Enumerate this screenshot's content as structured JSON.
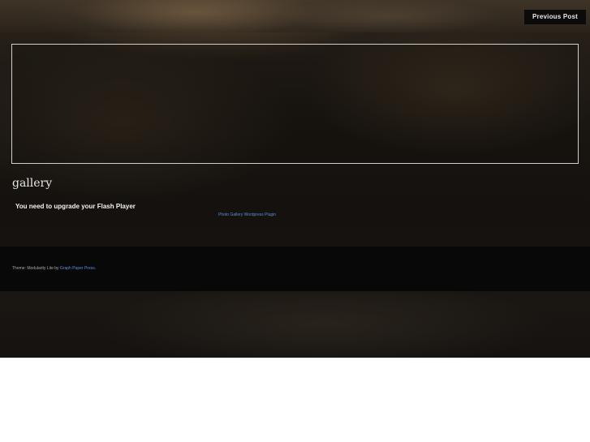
{
  "nav": {
    "previous_post_label": "Previous Post"
  },
  "post": {
    "title": "gallery",
    "flash_message": "You need to upgrade your Flash Player",
    "plugin_link": "Photo Gallery Wordpress Plugin"
  },
  "footer": {
    "credit_prefix": "Theme: Modularity Lite by ",
    "credit_link": "Graph Paper Press",
    "credit_suffix": "."
  },
  "colors": {
    "link": "#5b8fd6",
    "frame_border": "#cfcfcf",
    "footer_bg": "#080808"
  }
}
